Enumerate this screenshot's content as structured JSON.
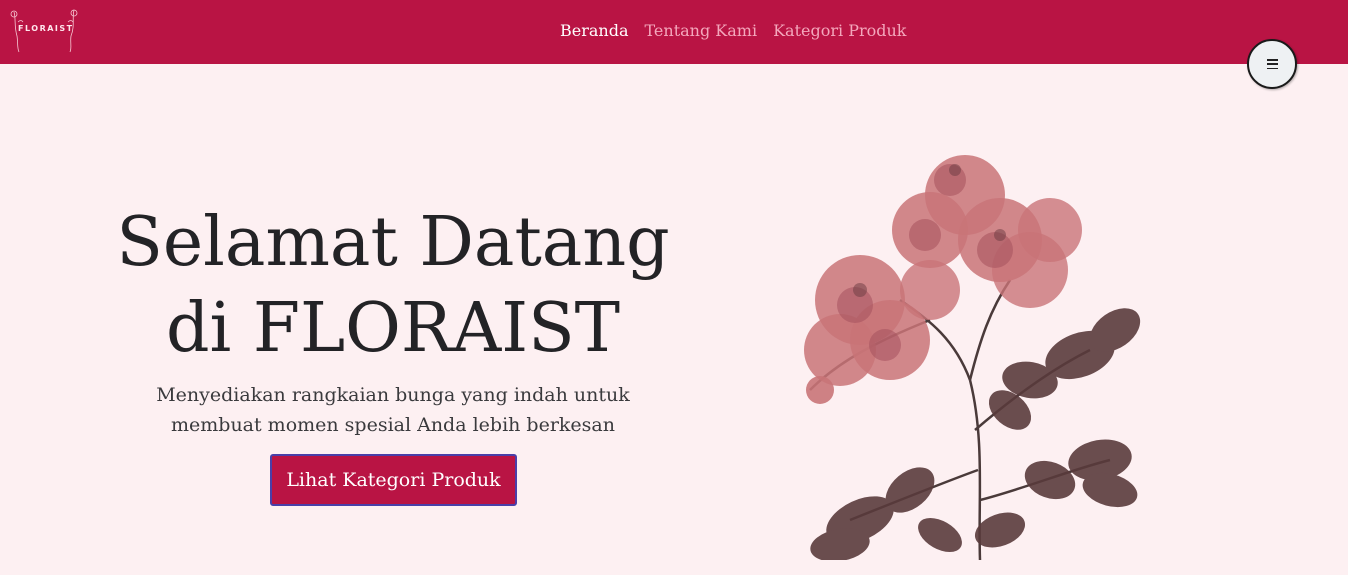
{
  "brand": {
    "logo_text": "FLORAIST"
  },
  "nav": {
    "links": [
      {
        "label": "Beranda",
        "active": true
      },
      {
        "label": "Tentang Kami",
        "active": false
      },
      {
        "label": "Kategori Produk",
        "active": false
      }
    ]
  },
  "menu_toggle": {
    "icon": "hamburger-icon"
  },
  "hero": {
    "title_line1": "Selamat Datang",
    "title_line2": "di FLORAIST",
    "subtitle_line1": "Menyediakan rangkaian bunga yang indah untuk",
    "subtitle_line2": "membuat momen spesial Anda lebih berkesan",
    "cta_label": "Lihat Kategori Produk"
  },
  "colors": {
    "brand": "#b91444",
    "background": "#fdf0f2",
    "nav_inactive": "#f4a7bc",
    "text": "#232326",
    "flower_petal": "#c97478",
    "flower_leaf": "#5a3a3c"
  }
}
